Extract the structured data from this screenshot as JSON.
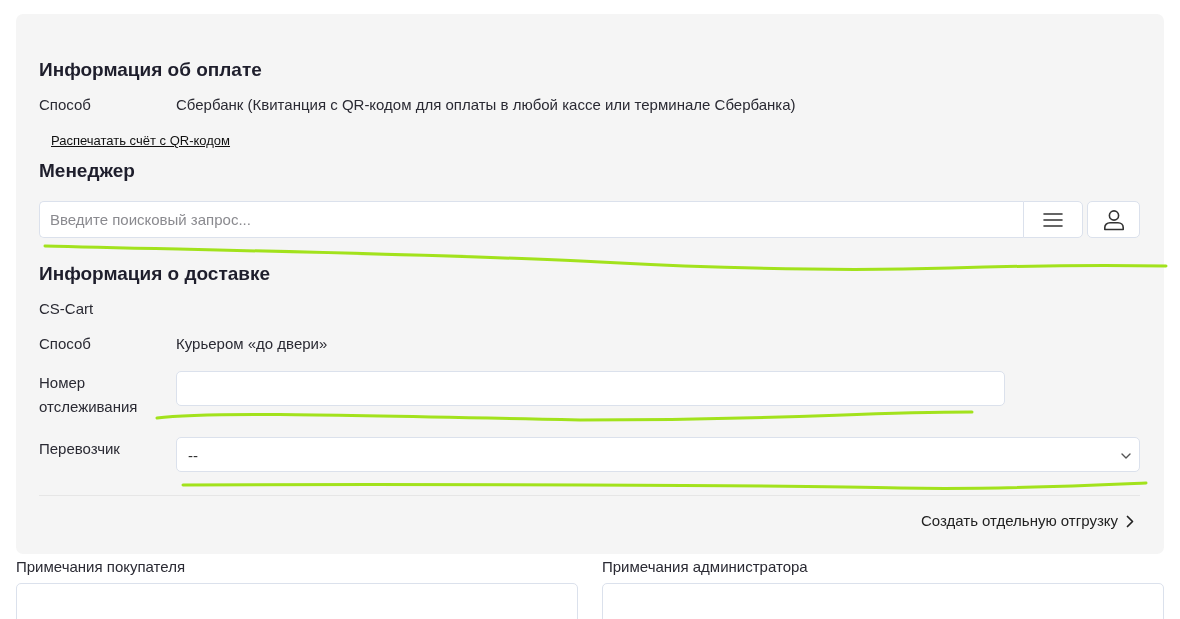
{
  "payment_info": {
    "title": "Информация об оплате",
    "fields": [
      {
        "label": "Способ",
        "value": "Сбербанк (Квитанция с QR-кодом для оплаты в любой кассе или терминале Сбербанка)"
      }
    ],
    "print_link": "Распечатать счёт с QR-кодом"
  },
  "manager": {
    "title": "Менеджер",
    "search": {
      "placeholder": "Введите поисковый запрос..."
    }
  },
  "shipping_info": {
    "title": "Информация о доставке",
    "provider": "CS-Cart",
    "fields": [
      {
        "kind": "text",
        "label": "Способ",
        "value": "Курьером «до двери»"
      },
      {
        "kind": "input",
        "label": "Номер отслеживания"
      },
      {
        "kind": "select",
        "label": "Перевозчик",
        "value": "--"
      }
    ],
    "create_shipment_link": "Создать отдельную отгрузку"
  },
  "notes": [
    {
      "label": "Примечания покупателя"
    },
    {
      "label": "Примечания администратора"
    }
  ]
}
